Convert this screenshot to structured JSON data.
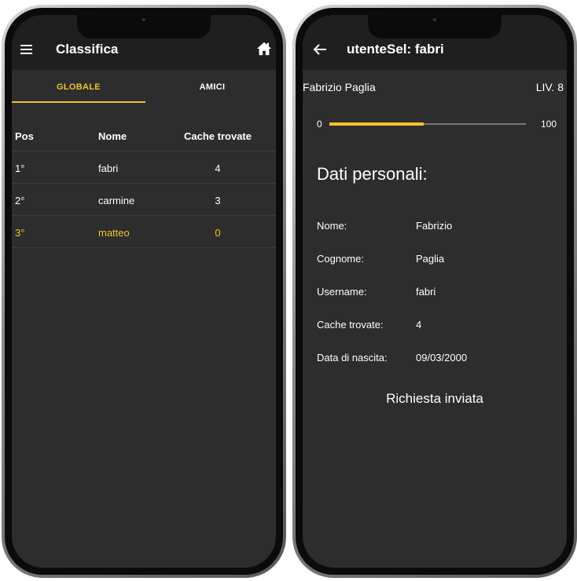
{
  "left_screen": {
    "title": "Classifica",
    "tabs": [
      {
        "label": "GLOBALE",
        "active": true
      },
      {
        "label": "AMICI",
        "active": false
      }
    ],
    "table": {
      "columns": [
        "Pos",
        "Nome",
        "Cache trovate"
      ],
      "rows": [
        {
          "pos": "1°",
          "nome": "fabri",
          "cache": "4",
          "highlight": false
        },
        {
          "pos": "2°",
          "nome": "carmine",
          "cache": "3",
          "highlight": false
        },
        {
          "pos": "3°",
          "nome": "matteo",
          "cache": "0",
          "highlight": true
        }
      ]
    },
    "icons": {
      "menu": "hamburger-menu-icon",
      "home": "home-icon"
    }
  },
  "right_screen": {
    "title": "utenteSel: fabri",
    "full_name": "Fabrizio Paglia",
    "level": "LIV. 8",
    "progress": {
      "min": "0",
      "max": "100",
      "value": 48
    },
    "section_title": "Dati personali:",
    "fields": [
      {
        "label": "Nome:",
        "value": "Fabrizio"
      },
      {
        "label": "Cognome:",
        "value": "Paglia"
      },
      {
        "label": "Username:",
        "value": "fabri"
      },
      {
        "label": "Cache trovate:",
        "value": "4"
      },
      {
        "label": "Data di nascita:",
        "value": "09/03/2000"
      }
    ],
    "status_text": "Richiesta inviata",
    "icons": {
      "back": "arrow-back-icon"
    }
  },
  "colors": {
    "accent": "#f5c32b",
    "background": "#2d2d2d",
    "appbar": "#1f1f1f",
    "text": "#ffffff"
  }
}
